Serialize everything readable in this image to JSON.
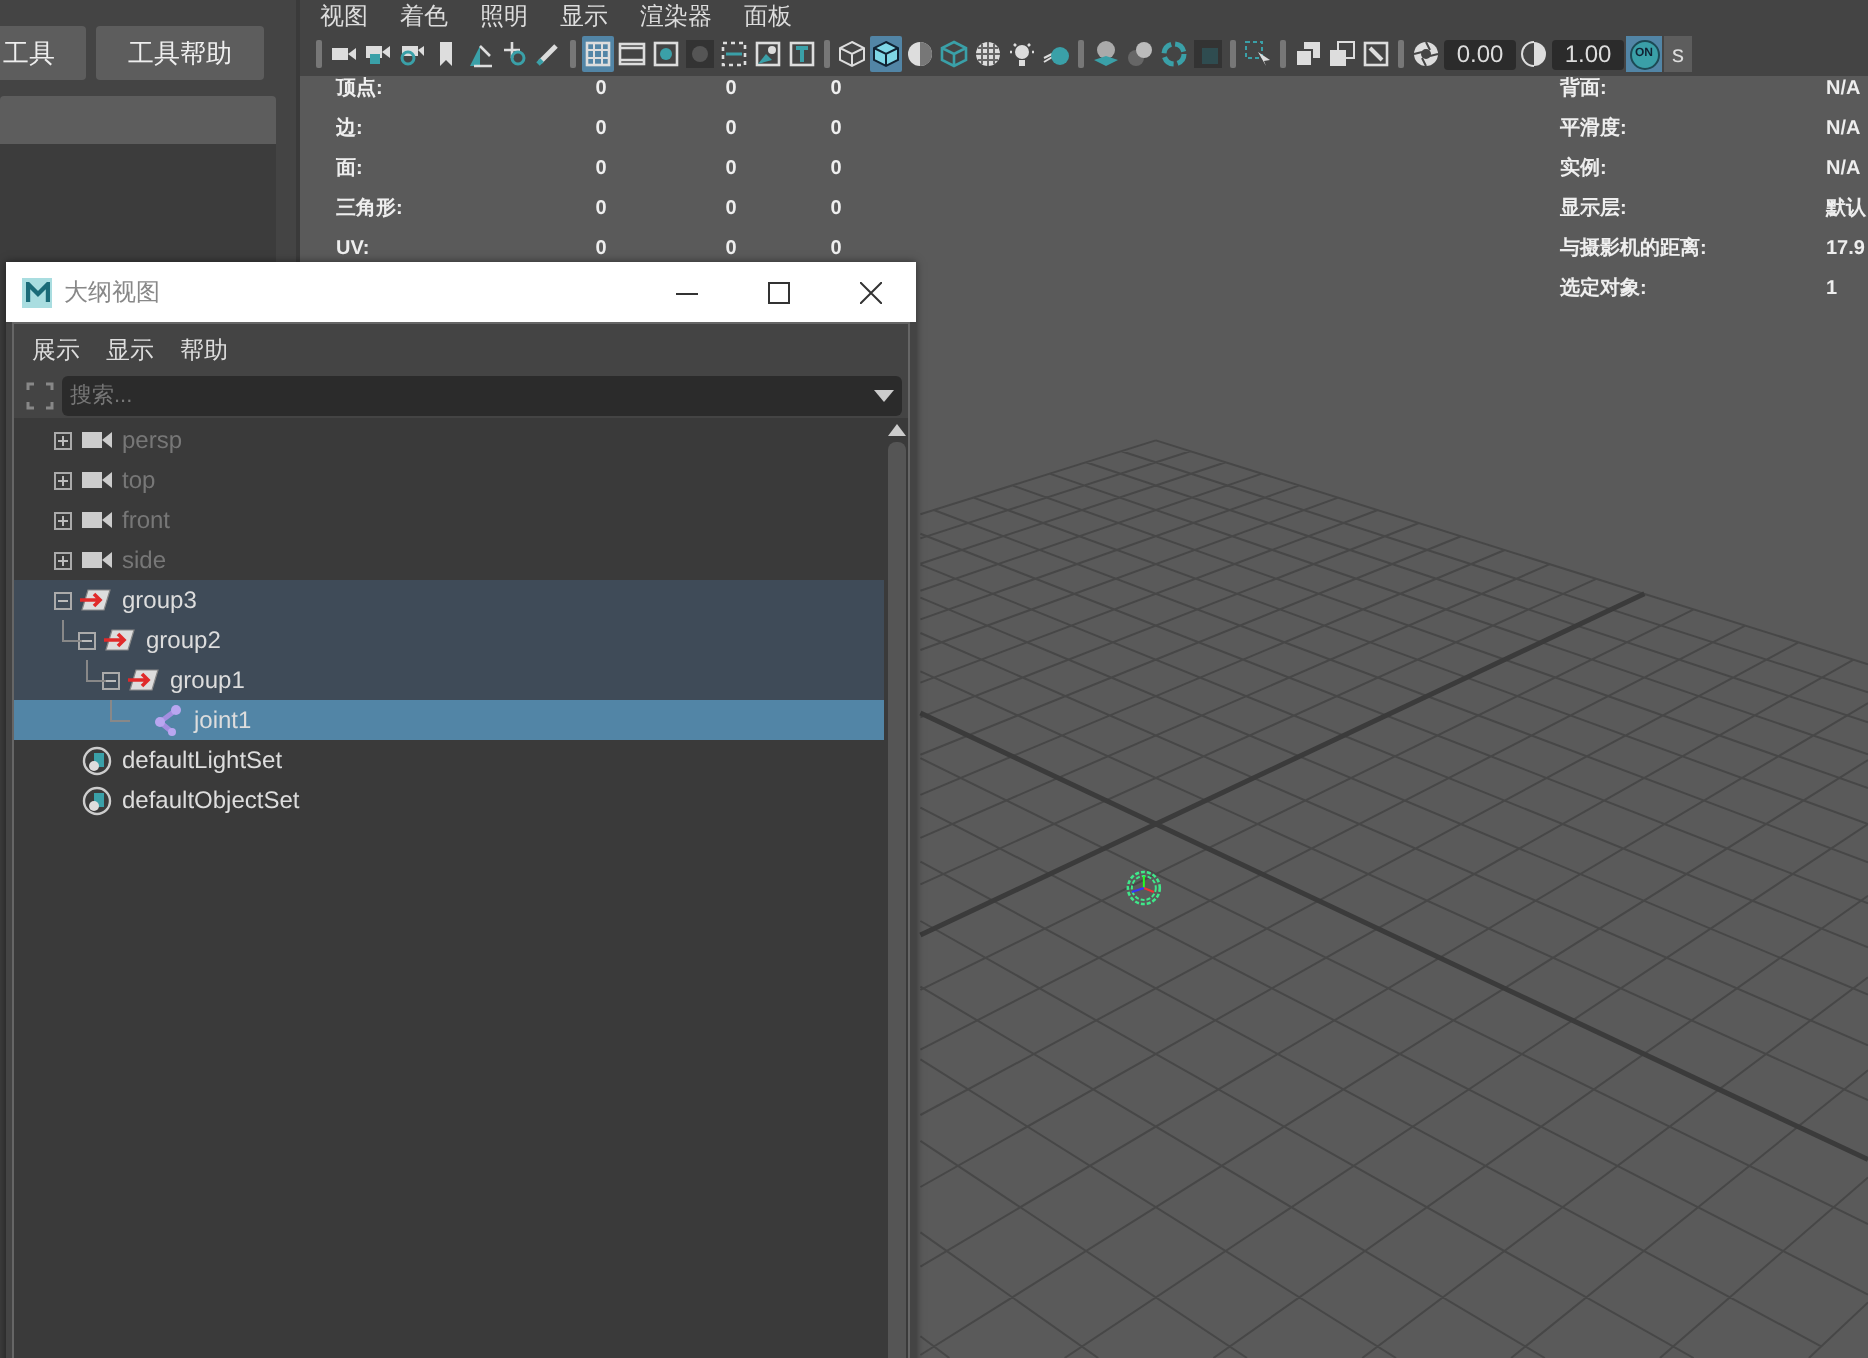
{
  "left_panel": {
    "buttons": [
      "工具",
      "工具帮助"
    ]
  },
  "viewport": {
    "menu": [
      "视图",
      "着色",
      "照明",
      "显示",
      "渲染器",
      "面板"
    ],
    "toolbar": [
      {
        "kind": "sep"
      },
      {
        "kind": "camera",
        "selected": false
      },
      {
        "kind": "camera-lock",
        "selected": false
      },
      {
        "kind": "camera-gear",
        "selected": false
      },
      {
        "kind": "bookmark",
        "selected": false
      },
      {
        "kind": "plane",
        "selected": false
      },
      {
        "kind": "move",
        "selected": false
      },
      {
        "kind": "pen",
        "selected": false
      },
      {
        "kind": "sep"
      },
      {
        "kind": "grid",
        "selected": true
      },
      {
        "kind": "film",
        "selected": false
      },
      {
        "kind": "dot-box",
        "selected": false
      },
      {
        "kind": "dark-dot",
        "selected": false
      },
      {
        "kind": "frame",
        "selected": false
      },
      {
        "kind": "image",
        "selected": false
      },
      {
        "kind": "letter-box",
        "selected": false
      },
      {
        "kind": "sep"
      },
      {
        "kind": "cube-wire",
        "selected": false
      },
      {
        "kind": "cube-solid",
        "selected": true
      },
      {
        "kind": "half-sphere",
        "selected": false
      },
      {
        "kind": "cube-outline",
        "selected": false
      },
      {
        "kind": "checker",
        "selected": false
      },
      {
        "kind": "bulb",
        "selected": false
      },
      {
        "kind": "ball",
        "selected": false
      },
      {
        "kind": "sep"
      },
      {
        "kind": "sphere-stack",
        "selected": false
      },
      {
        "kind": "spheres",
        "selected": false
      },
      {
        "kind": "ring",
        "selected": false
      },
      {
        "kind": "dark-square",
        "selected": false
      },
      {
        "kind": "sep"
      },
      {
        "kind": "select",
        "selected": false
      },
      {
        "kind": "sep"
      },
      {
        "kind": "copy",
        "selected": false
      },
      {
        "kind": "square2",
        "selected": false
      },
      {
        "kind": "pen-box",
        "selected": false
      },
      {
        "kind": "sep"
      },
      {
        "kind": "aperture",
        "selected": false
      },
      {
        "kind": "field",
        "value": "0.00"
      },
      {
        "kind": "half-circle",
        "selected": false
      },
      {
        "kind": "field",
        "value": "1.00"
      },
      {
        "kind": "toggle",
        "label": "ON",
        "selected": true
      },
      {
        "kind": "cut-label",
        "label": "s"
      }
    ],
    "hud_left": [
      {
        "label": "顶点:",
        "values": [
          "0",
          "0",
          "0"
        ]
      },
      {
        "label": "边:",
        "values": [
          "0",
          "0",
          "0"
        ]
      },
      {
        "label": "面:",
        "values": [
          "0",
          "0",
          "0"
        ]
      },
      {
        "label": "三角形:",
        "values": [
          "0",
          "0",
          "0"
        ]
      },
      {
        "label": "UV:",
        "values": [
          "0",
          "0",
          "0"
        ]
      }
    ],
    "hud_right": [
      {
        "label": "背面:",
        "value": "N/A"
      },
      {
        "label": "平滑度:",
        "value": "N/A"
      },
      {
        "label": "实例:",
        "value": "N/A"
      },
      {
        "label": "显示层:",
        "value": "默认"
      },
      {
        "label": "与摄影机的距离:",
        "value": "17.9"
      },
      {
        "label": "选定对象:",
        "value": "1"
      }
    ]
  },
  "outliner": {
    "title": "大纲视图",
    "menu": [
      "展示",
      "显示",
      "帮助"
    ],
    "search": {
      "placeholder": "搜索..."
    },
    "items": [
      {
        "name": "persp",
        "kind": "camera",
        "dimmed": true,
        "expanded": false,
        "selected": false,
        "highlighted": false
      },
      {
        "name": "top",
        "kind": "camera",
        "dimmed": true,
        "expanded": false,
        "selected": false,
        "highlighted": false
      },
      {
        "name": "front",
        "kind": "camera",
        "dimmed": true,
        "expanded": false,
        "selected": false,
        "highlighted": false
      },
      {
        "name": "side",
        "kind": "camera",
        "dimmed": true,
        "expanded": false,
        "selected": false,
        "highlighted": false
      },
      {
        "name": "group3",
        "kind": "group",
        "dimmed": false,
        "expanded": true,
        "selected": false,
        "highlighted": true,
        "children": [
          {
            "name": "group2",
            "kind": "group",
            "dimmed": false,
            "expanded": true,
            "selected": false,
            "highlighted": true,
            "children": [
              {
                "name": "group1",
                "kind": "group",
                "dimmed": false,
                "expanded": true,
                "selected": false,
                "highlighted": true,
                "children": [
                  {
                    "name": "joint1",
                    "kind": "joint",
                    "dimmed": false,
                    "selected": true
                  }
                ]
              }
            ]
          }
        ]
      },
      {
        "name": "defaultLightSet",
        "kind": "set",
        "dimmed": false,
        "selected": false,
        "highlighted": false
      },
      {
        "name": "defaultObjectSet",
        "kind": "set",
        "dimmed": false,
        "selected": false,
        "highlighted": false
      }
    ]
  }
}
